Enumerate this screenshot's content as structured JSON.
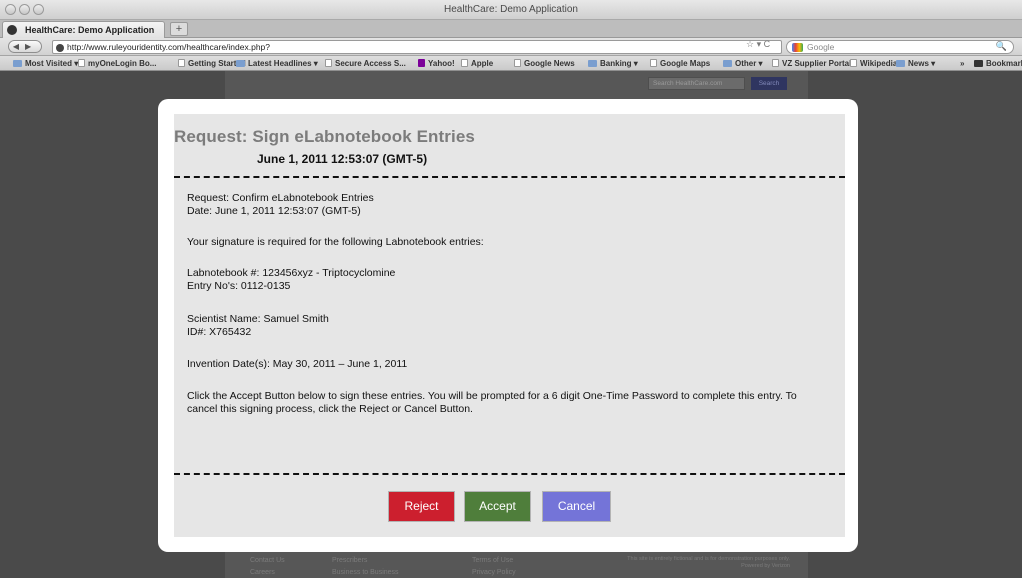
{
  "window": {
    "title": "HealthCare: Demo Application"
  },
  "tab": {
    "label": "HealthCare: Demo Application",
    "new_tab": "+"
  },
  "nav": {
    "url": "http://www.ruleyouridentity.com/healthcare/index.php?",
    "search_placeholder": "Google"
  },
  "bookmarks": [
    {
      "label": "Most Visited ▾",
      "icon": "folder"
    },
    {
      "label": "myOneLogin Bo...",
      "icon": "page"
    },
    {
      "label": "Getting Started",
      "icon": "page"
    },
    {
      "label": "Latest Headlines ▾",
      "icon": "folder"
    },
    {
      "label": "Secure Access S...",
      "icon": "page"
    },
    {
      "label": "Yahoo!",
      "icon": "yahoo"
    },
    {
      "label": "Apple",
      "icon": "page"
    },
    {
      "label": "Google News",
      "icon": "page"
    },
    {
      "label": "Banking ▾",
      "icon": "folder"
    },
    {
      "label": "Google Maps",
      "icon": "page"
    },
    {
      "label": "Other ▾",
      "icon": "folder"
    },
    {
      "label": "VZ Supplier Portal",
      "icon": "page"
    },
    {
      "label": "Wikipedia",
      "icon": "page"
    },
    {
      "label": "News ▾",
      "icon": "folder"
    },
    {
      "label": "»",
      "icon": "none"
    },
    {
      "label": "Bookmarks",
      "icon": "dark"
    }
  ],
  "background_page": {
    "search_placeholder": "Search HealthCare.com",
    "search_button": "Search",
    "footer": {
      "col1": [
        "Contact Us",
        "Careers"
      ],
      "col2": [
        "Prescribers",
        "Business to Business"
      ],
      "col3": [
        "Terms of Use",
        "Privacy Policy"
      ],
      "note1": "This site is entirely fictional and is for demonstration purposes only.",
      "note2": "Powered by Verizon"
    }
  },
  "modal": {
    "title": "Request:  Sign eLabnotebook Entries",
    "datetime": "June 1, 2011 12:53:07 (GMT-5)",
    "request_line": "Request:  Confirm eLabnotebook Entries",
    "date_line": "Date:  June 1, 2011 12:53:07 (GMT-5)",
    "signature_required": "Your signature is required for the following Labnotebook entries:",
    "labnotebook": "Labnotebook #:  123456xyz - Triptocyclomine",
    "entries": "Entry No's:  0112-0135",
    "scientist": "Scientist Name:  Samuel Smith",
    "id": "ID#:  X765432",
    "invention_dates": "Invention Date(s):  May 30, 2011 – June 1, 2011",
    "instructions": "Click the Accept Button below to sign these entries.  You will be prompted for a 6 digit One-Time Password to complete this entry.  To cancel this signing process, click the Reject or Cancel Button.",
    "buttons": {
      "reject": "Reject",
      "accept": "Accept",
      "cancel": "Cancel"
    }
  },
  "colors": {
    "reject": "#cc1f2e",
    "accept": "#4f7e3b",
    "cancel": "#7474d8",
    "title": "#7c7c7c"
  }
}
